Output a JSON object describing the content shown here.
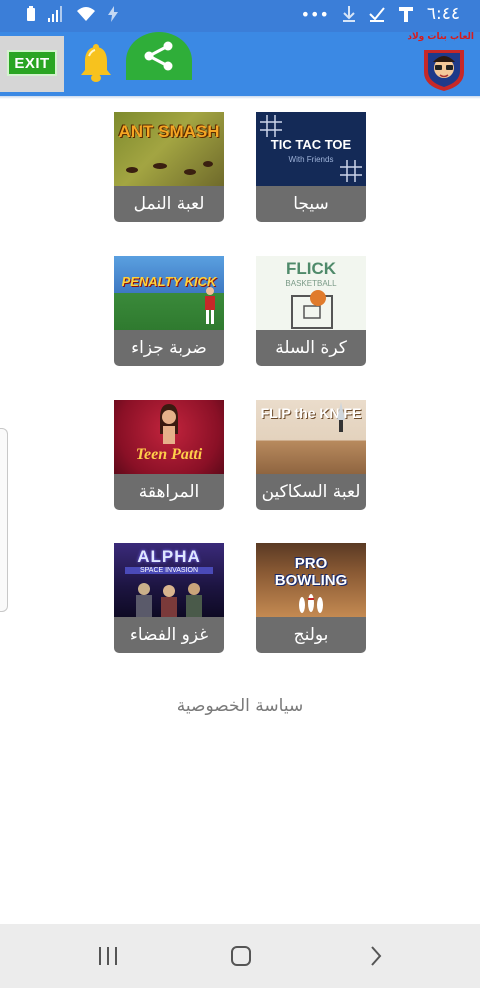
{
  "status_bar": {
    "time": "٦:٤٤",
    "icons": [
      "battery-icon",
      "signal-icon",
      "wifi-icon",
      "flash-icon",
      "more-icon",
      "download-icon",
      "check-icon",
      "t-icon"
    ]
  },
  "toolbar": {
    "exit_label": "EXIT",
    "logo_text": "العاب بنات ولاد",
    "colors": {
      "bar": "#3b89e4",
      "exit": "#2aa523",
      "share": "#2fae39",
      "bell": "#f7c21e"
    }
  },
  "games": [
    {
      "thumb_title": "ANT SMASH",
      "label": "لعبة النمل"
    },
    {
      "thumb_title": "TIC TAC TOE",
      "thumb_subtitle": "With Friends",
      "label": "سيجا"
    },
    {
      "thumb_title": "PENALTY KICK",
      "label": "ضربة جزاء"
    },
    {
      "thumb_title": "FLICK",
      "thumb_subtitle": "BASKETBALL",
      "label": "كرة السلة"
    },
    {
      "thumb_title": "Teen Patti",
      "label": "المراهقة"
    },
    {
      "thumb_title": "FLIP the KNIFE",
      "label": "لعبة السكاكين"
    },
    {
      "thumb_title": "ALPHA",
      "thumb_subtitle": "SPACE INVASION",
      "label": "غزو الفضاء"
    },
    {
      "thumb_title": "PRO BOWLING",
      "label": "بولنج"
    }
  ],
  "privacy_label": "سياسة الخصوصية"
}
